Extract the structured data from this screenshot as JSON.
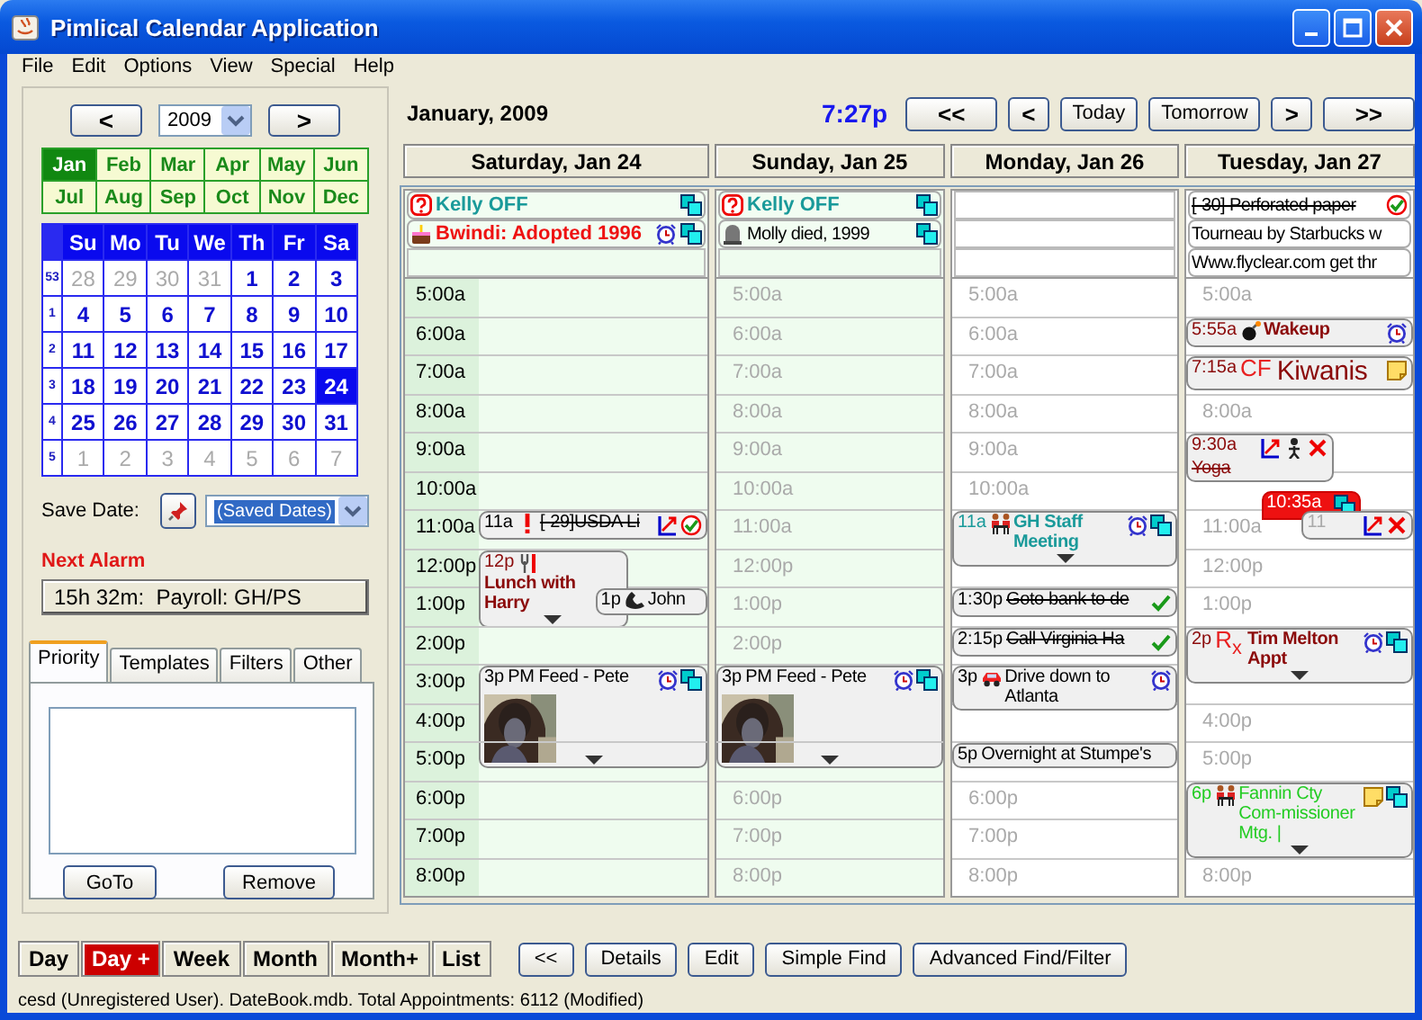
{
  "window": {
    "title": "Pimlical Calendar Application"
  },
  "menu": [
    "File",
    "Edit",
    "Options",
    "View",
    "Special",
    "Help"
  ],
  "year_nav": {
    "prev": "<",
    "year": "2009",
    "next": ">"
  },
  "months": [
    {
      "label": "Jan",
      "selected": true
    },
    {
      "label": "Feb",
      "selected": false
    },
    {
      "label": "Mar",
      "selected": false
    },
    {
      "label": "Apr",
      "selected": false
    },
    {
      "label": "May",
      "selected": false
    },
    {
      "label": "Jun",
      "selected": false
    },
    {
      "label": "Jul",
      "selected": false
    },
    {
      "label": "Aug",
      "selected": false
    },
    {
      "label": "Sep",
      "selected": false
    },
    {
      "label": "Oct",
      "selected": false
    },
    {
      "label": "Nov",
      "selected": false
    },
    {
      "label": "Dec",
      "selected": false
    }
  ],
  "calendar": {
    "weekdays": [
      "Su",
      "Mo",
      "Tu",
      "We",
      "Th",
      "Fr",
      "Sa"
    ],
    "weeks": [
      {
        "number": "53",
        "days": [
          {
            "label": "28",
            "other": true,
            "selected": false
          },
          {
            "label": "29",
            "other": true,
            "selected": false
          },
          {
            "label": "30",
            "other": true,
            "selected": false
          },
          {
            "label": "31",
            "other": true,
            "selected": false
          },
          {
            "label": "1",
            "other": false,
            "selected": false
          },
          {
            "label": "2",
            "other": false,
            "selected": false
          },
          {
            "label": "3",
            "other": false,
            "selected": false
          }
        ]
      },
      {
        "number": "1",
        "days": [
          {
            "label": "4",
            "other": false,
            "selected": false
          },
          {
            "label": "5",
            "other": false,
            "selected": false
          },
          {
            "label": "6",
            "other": false,
            "selected": false
          },
          {
            "label": "7",
            "other": false,
            "selected": false
          },
          {
            "label": "8",
            "other": false,
            "selected": false
          },
          {
            "label": "9",
            "other": false,
            "selected": false
          },
          {
            "label": "10",
            "other": false,
            "selected": false
          }
        ]
      },
      {
        "number": "2",
        "days": [
          {
            "label": "11",
            "other": false,
            "selected": false
          },
          {
            "label": "12",
            "other": false,
            "selected": false
          },
          {
            "label": "13",
            "other": false,
            "selected": false
          },
          {
            "label": "14",
            "other": false,
            "selected": false
          },
          {
            "label": "15",
            "other": false,
            "selected": false
          },
          {
            "label": "16",
            "other": false,
            "selected": false
          },
          {
            "label": "17",
            "other": false,
            "selected": false
          }
        ]
      },
      {
        "number": "3",
        "days": [
          {
            "label": "18",
            "other": false,
            "selected": false
          },
          {
            "label": "19",
            "other": false,
            "selected": false
          },
          {
            "label": "20",
            "other": false,
            "selected": false
          },
          {
            "label": "21",
            "other": false,
            "selected": false
          },
          {
            "label": "22",
            "other": false,
            "selected": false
          },
          {
            "label": "23",
            "other": false,
            "selected": false
          },
          {
            "label": "24",
            "other": false,
            "selected": true
          }
        ]
      },
      {
        "number": "4",
        "days": [
          {
            "label": "25",
            "other": false,
            "selected": false
          },
          {
            "label": "26",
            "other": false,
            "selected": false
          },
          {
            "label": "27",
            "other": false,
            "selected": false
          },
          {
            "label": "28",
            "other": false,
            "selected": false
          },
          {
            "label": "29",
            "other": false,
            "selected": false
          },
          {
            "label": "30",
            "other": false,
            "selected": false
          },
          {
            "label": "31",
            "other": false,
            "selected": false
          }
        ]
      },
      {
        "number": "5",
        "days": [
          {
            "label": "1",
            "other": true,
            "selected": false
          },
          {
            "label": "2",
            "other": true,
            "selected": false
          },
          {
            "label": "3",
            "other": true,
            "selected": false
          },
          {
            "label": "4",
            "other": true,
            "selected": false
          },
          {
            "label": "5",
            "other": true,
            "selected": false
          },
          {
            "label": "6",
            "other": true,
            "selected": false
          },
          {
            "label": "7",
            "other": true,
            "selected": false
          }
        ]
      }
    ]
  },
  "save_date": {
    "label": "Save Date:",
    "value": "(Saved Dates)"
  },
  "next_alarm": {
    "label": "Next Alarm",
    "value": "15h 32m:  Payroll: GH/PS"
  },
  "tabs": [
    {
      "label": "Priority",
      "selected": true
    },
    {
      "label": "Templates",
      "selected": false
    },
    {
      "label": "Filters",
      "selected": false
    },
    {
      "label": "Other",
      "selected": false
    }
  ],
  "tab_buttons": [
    "GoTo",
    "Remove"
  ],
  "header": {
    "month": "January, 2009",
    "time": "7:27p",
    "nav": [
      "<<",
      "<",
      "Today",
      "Tomorrow",
      ">",
      ">>"
    ]
  },
  "days": [
    {
      "title": "Saturday, Jan 24",
      "weekend": true,
      "strip": true,
      "all_day": [
        {
          "lead": [
            {
              "kind": "question"
            }
          ],
          "title": "Kelly OFF",
          "color": "#1a9a9a",
          "bold": true,
          "struck": false,
          "tail": [
            {
              "kind": "copy"
            }
          ]
        },
        {
          "lead": [
            {
              "kind": "cake"
            }
          ],
          "title": "Bwindi: Adopted 1996",
          "color": "#ee1111",
          "bold": true,
          "struck": false,
          "tail": [
            {
              "kind": "alarm"
            },
            {
              "kind": "copy"
            }
          ]
        }
      ],
      "slots": [
        {
          "kind": "hour",
          "label": "5:00a"
        },
        {
          "kind": "hour",
          "label": "6:00a"
        },
        {
          "kind": "hour",
          "label": "7:00a"
        },
        {
          "kind": "hour",
          "label": "8:00a"
        },
        {
          "kind": "hour",
          "label": "9:00a"
        },
        {
          "kind": "hour",
          "label": "10:00a"
        },
        {
          "kind": "hour",
          "label": "11:00a",
          "events": [
            {
              "kind": "card",
              "time": "11a",
              "lead": [
                {
                  "kind": "exclaim"
                }
              ],
              "title": "[-29]USDA Li",
              "color": "#000000",
              "bold": false,
              "struck": true,
              "tail": [
                {
                  "kind": "chart"
                },
                {
                  "kind": "checkcircle"
                }
              ],
              "more": false
            }
          ]
        },
        {
          "kind": "hour",
          "label": "12:00p",
          "events": [
            {
              "kind": "half-card",
              "time": "12p",
              "lead": [
                {
                  "kind": "fork"
                }
              ],
              "title": "Lunch with Harry",
              "color": "#8b0a0a",
              "bold": true,
              "struck": false,
              "more": true
            }
          ]
        },
        {
          "kind": "hour",
          "label": "1:00p",
          "events": [
            {
              "kind": "side-card",
              "time": "1p",
              "lead": [
                {
                  "kind": "phone"
                }
              ],
              "title": "John",
              "color": "#000000",
              "bold": false,
              "struck": false,
              "more": false
            }
          ]
        },
        {
          "kind": "hour",
          "label": "2:00p"
        },
        {
          "kind": "hour",
          "label": "3:00p",
          "events": [
            {
              "kind": "card",
              "time": "3p",
              "title": "PM Feed - Pete",
              "color": "#000000",
              "bold": false,
              "struck": false,
              "tail": [
                {
                  "kind": "alarm"
                },
                {
                  "kind": "copy"
                }
              ],
              "more": true,
              "picture": true
            }
          ]
        },
        {
          "kind": "hour",
          "label": "4:00p"
        },
        {
          "kind": "hour",
          "label": "5:00p"
        },
        {
          "kind": "hour",
          "label": "6:00p"
        },
        {
          "kind": "hour",
          "label": "7:00p"
        },
        {
          "kind": "hour",
          "label": "8:00p"
        }
      ]
    },
    {
      "title": "Sunday, Jan 25",
      "weekend": true,
      "strip": false,
      "all_day": [
        {
          "lead": [
            {
              "kind": "question"
            }
          ],
          "title": "Kelly OFF",
          "color": "#1a9a9a",
          "bold": true,
          "struck": false,
          "tail": [
            {
              "kind": "copy"
            }
          ]
        },
        {
          "lead": [
            {
              "kind": "tombstone"
            }
          ],
          "title": "Molly died, 1999",
          "color": "#000000",
          "bold": false,
          "struck": false,
          "tail": [
            {
              "kind": "copy"
            }
          ]
        }
      ],
      "slots": [
        {
          "kind": "hour",
          "label": "5:00a"
        },
        {
          "kind": "hour",
          "label": "6:00a"
        },
        {
          "kind": "hour",
          "label": "7:00a"
        },
        {
          "kind": "hour",
          "label": "8:00a"
        },
        {
          "kind": "hour",
          "label": "9:00a"
        },
        {
          "kind": "hour",
          "label": "10:00a"
        },
        {
          "kind": "hour",
          "label": "11:00a"
        },
        {
          "kind": "hour",
          "label": "12:00p"
        },
        {
          "kind": "hour",
          "label": "1:00p"
        },
        {
          "kind": "hour",
          "label": "2:00p"
        },
        {
          "kind": "covered",
          "events": [
            {
              "kind": "card",
              "time": "3p",
              "title": "PM Feed - Pete",
              "color": "#000000",
              "bold": false,
              "struck": false,
              "tail": [
                {
                  "kind": "alarm"
                },
                {
                  "kind": "copy"
                }
              ],
              "more": true,
              "picture": true
            }
          ]
        },
        {
          "kind": "covered"
        },
        {
          "kind": "covered"
        },
        {
          "kind": "hour",
          "label": "6:00p"
        },
        {
          "kind": "hour",
          "label": "7:00p"
        },
        {
          "kind": "hour",
          "label": "8:00p"
        }
      ]
    },
    {
      "title": "Monday, Jan 26",
      "weekend": false,
      "strip": false,
      "slots": [
        {
          "kind": "hour",
          "label": "5:00a"
        },
        {
          "kind": "hour",
          "label": "6:00a"
        },
        {
          "kind": "hour",
          "label": "7:00a"
        },
        {
          "kind": "hour",
          "label": "8:00a"
        },
        {
          "kind": "hour",
          "label": "9:00a"
        },
        {
          "kind": "hour",
          "label": "10:00a"
        },
        {
          "kind": "covered",
          "events": [
            {
              "kind": "card",
              "time": "11a",
              "lead": [
                {
                  "kind": "people"
                }
              ],
              "title": "GH Staff Meeting",
              "color": "#1a9a9a",
              "bold": true,
              "struck": false,
              "tail": [
                {
                  "kind": "alarm"
                },
                {
                  "kind": "copy"
                }
              ],
              "more": true
            }
          ]
        },
        {
          "kind": "covered"
        },
        {
          "kind": "covered",
          "events": [
            {
              "kind": "card",
              "time": "1:30p",
              "title": "Goto bank to de",
              "color": "#000000",
              "bold": false,
              "struck": true,
              "tail": [
                {
                  "kind": "check"
                }
              ],
              "more": false
            }
          ]
        },
        {
          "kind": "covered",
          "events": [
            {
              "kind": "card",
              "time": "2:15p",
              "title": "Call Virginia Ha",
              "color": "#000000",
              "bold": false,
              "struck": true,
              "tail": [
                {
                  "kind": "check"
                }
              ],
              "more": false
            }
          ]
        },
        {
          "kind": "covered",
          "events": [
            {
              "kind": "card",
              "time": "3p",
              "lead": [
                {
                  "kind": "car"
                }
              ],
              "title": "Drive down to Atlanta",
              "color": "#000000",
              "bold": false,
              "struck": false,
              "tail": [
                {
                  "kind": "alarm"
                }
              ],
              "more": false
            }
          ]
        },
        {
          "kind": "covered"
        },
        {
          "kind": "covered",
          "events": [
            {
              "kind": "card",
              "time": "5p",
              "title": "Overnight at Stumpe's",
              "color": "#000000",
              "bold": false,
              "struck": false,
              "more": false
            }
          ]
        },
        {
          "kind": "hour",
          "label": "6:00p"
        },
        {
          "kind": "hour",
          "label": "7:00p"
        },
        {
          "kind": "hour",
          "label": "8:00p"
        }
      ]
    },
    {
      "title": "Tuesday, Jan 27",
      "weekend": false,
      "strip": false,
      "all_day": [
        {
          "title": "[-30] Perforated paper",
          "color": "#000000",
          "bold": false,
          "struck": true,
          "tail": [
            {
              "kind": "checkcircle"
            }
          ]
        },
        {
          "title": "Tourneau by Starbucks w",
          "color": "#000000",
          "bold": false,
          "struck": false
        },
        {
          "title": "Www.flyclear.com get thr",
          "color": "#000000",
          "bold": false,
          "struck": false
        }
      ],
      "slots": [
        {
          "kind": "hour",
          "label": "5:00a"
        },
        {
          "kind": "covered",
          "events": [
            {
              "kind": "card",
              "time": "5:55a",
              "lead": [
                {
                  "kind": "bomb"
                }
              ],
              "title": "Wakeup",
              "color": "#8b0a0a",
              "bold": true,
              "struck": false,
              "tail": [
                {
                  "kind": "alarm"
                }
              ],
              "more": false
            }
          ]
        },
        {
          "kind": "covered",
          "events": [
            {
              "kind": "large-card",
              "time": "7:15a",
              "tag": "CF",
              "title": "Kiwanis",
              "color": "#8b0a0a",
              "bold": false,
              "struck": false,
              "tail": [
                {
                  "kind": "note"
                }
              ],
              "more": false
            }
          ]
        },
        {
          "kind": "hour",
          "label": "8:00a"
        },
        {
          "kind": "covered",
          "events": [
            {
              "kind": "half-card",
              "time": "9:30a",
              "title": "Yoga",
              "color": "#8b0a0a",
              "bold": false,
              "struck": true,
              "tail": [
                {
                  "kind": "chart"
                },
                {
                  "kind": "person"
                },
                {
                  "kind": "cross"
                }
              ],
              "more": false
            }
          ]
        },
        {
          "kind": "covered",
          "events": [
            {
              "kind": "badge",
              "time": "10:35a",
              "tail": [
                {
                  "kind": "copy"
                }
              ],
              "more": false
            }
          ]
        },
        {
          "kind": "hour",
          "label": "11:00a",
          "events": [
            {
              "kind": "side-card",
              "time": "11",
              "tail": [
                {
                  "kind": "chart"
                },
                {
                  "kind": "cross"
                }
              ],
              "more": false
            }
          ]
        },
        {
          "kind": "hour",
          "label": "12:00p"
        },
        {
          "kind": "hour",
          "label": "1:00p"
        },
        {
          "kind": "covered",
          "events": [
            {
              "kind": "card",
              "time": "2p",
              "tag": "R$_{x}$",
              "title": "Tim Melton Appt",
              "color": "#8b0a0a",
              "bold": true,
              "struck": false,
              "tail": [
                {
                  "kind": "alarm"
                },
                {
                  "kind": "copy"
                }
              ],
              "more": true
            }
          ]
        },
        {
          "kind": "covered"
        },
        {
          "kind": "hour",
          "label": "4:00p"
        },
        {
          "kind": "hour",
          "label": "5:00p"
        },
        {
          "kind": "covered",
          "events": [
            {
              "kind": "card",
              "time": "6p",
              "lead": [
                {
                  "kind": "people"
                }
              ],
              "title": "Fannin Cty Com-missioner Mtg. |",
              "color": "#22cc22",
              "bold": false,
              "struck": false,
              "tail": [
                {
                  "kind": "note"
                },
                {
                  "kind": "copy"
                }
              ],
              "more": true
            }
          ]
        },
        {
          "kind": "covered"
        },
        {
          "kind": "hour",
          "label": "8:00p"
        }
      ]
    }
  ],
  "views": [
    {
      "label": "Day",
      "selected": false
    },
    {
      "label": "Day +",
      "selected": true
    },
    {
      "label": "Week",
      "selected": false
    },
    {
      "label": "Month",
      "selected": false
    },
    {
      "label": "Month+",
      "selected": false
    },
    {
      "label": "List",
      "selected": false
    }
  ],
  "actions": [
    "<<",
    "Details",
    "Edit",
    "Simple Find",
    "Advanced Find/Filter"
  ],
  "status_bar": "cesd (Unregistered User). DateBook.mdb. Total Appointments: 6112 (Modified)"
}
